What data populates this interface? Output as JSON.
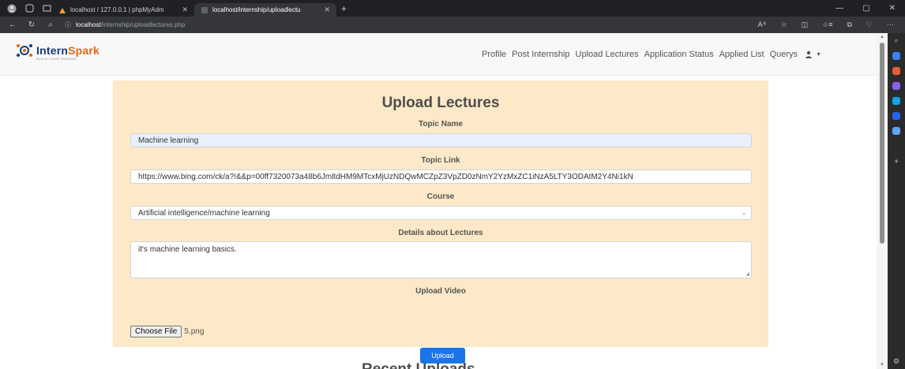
{
  "browser": {
    "tabs": [
      {
        "label": "localhost / 127.0.0.1 | phpMyAdm",
        "active": false
      },
      {
        "label": "localhost/internship/uploadlectu",
        "active": true
      }
    ],
    "url_host": "localhost",
    "url_path": "/internship/uploadlectures.php"
  },
  "navbar": {
    "logo_main": "Intern",
    "logo_accent": "Spark",
    "logo_tagline": "BUILD YOUR DREAMS",
    "links": [
      "Profile",
      "Post Internship",
      "Upload Lectures",
      "Application Status",
      "Applied List",
      "Querys"
    ]
  },
  "form": {
    "title": "Upload Lectures",
    "topic_name_label": "Topic Name",
    "topic_name_value": "Machine learning",
    "topic_link_label": "Topic Link",
    "topic_link_value": "https://www.bing.com/ck/a?!&&p=00ff7320073a48b6JmltdHM9MTcxMjUzNDQwMCZpZ3VpZD0zNmY2YzMxZC1iNzA5LTY3ODAtM2Y4Ni1kN",
    "course_label": "Course",
    "course_value": "Artificial intelligence/machine learning",
    "details_label": "Details about Lectures",
    "details_value": "it's machine learning basics.",
    "video_label": "Upload Video",
    "file_button": "Choose File",
    "file_name": "5.png",
    "submit": "Upload"
  },
  "below_heading": "Recent Uploads",
  "colors": {
    "card_bg": "#fde8c8",
    "accent_blue": "#1a73e8",
    "logo_blue": "#1b3a7a",
    "logo_orange": "#e0661b"
  }
}
